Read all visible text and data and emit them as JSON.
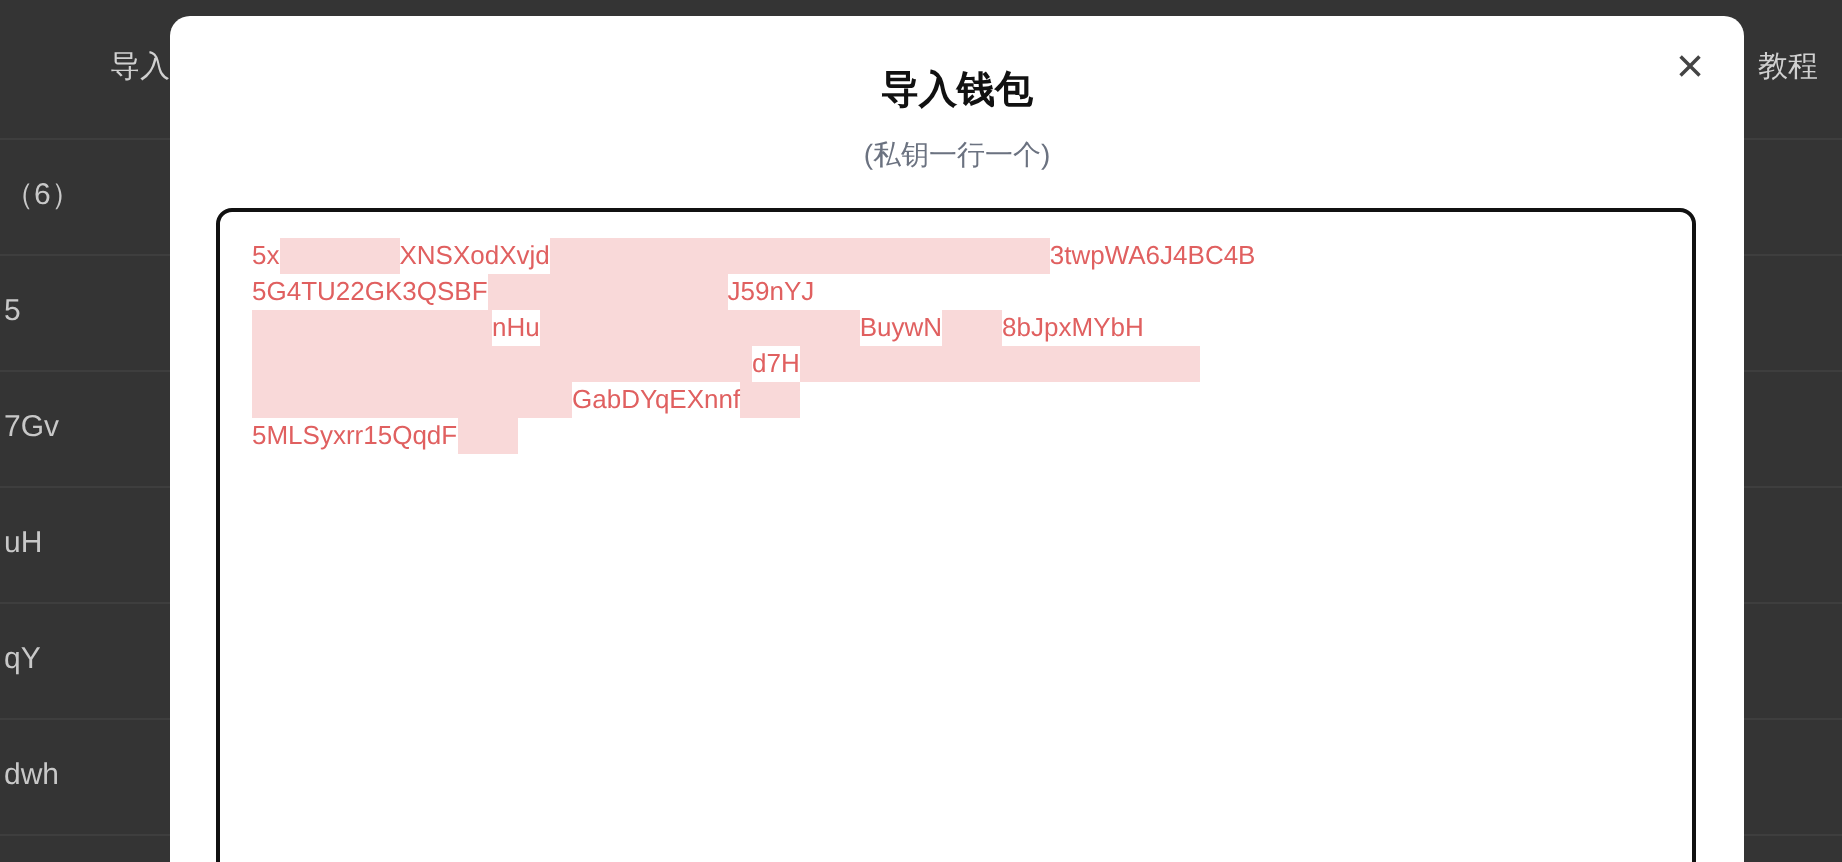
{
  "background_table": {
    "header": [
      "导入",
      "教程"
    ],
    "rows": [
      "（6）",
      "5",
      "7Gv",
      "uH",
      "qY",
      "dwh"
    ]
  },
  "dialog": {
    "title": "导入钱包",
    "subtitle": "(私钥一行一个)",
    "close": "×",
    "lines": [
      [
        {
          "kind": "text",
          "text": "5x"
        },
        {
          "kind": "mosaic"
        },
        {
          "kind": "text",
          "text": "XNSXodXvjd"
        },
        {
          "kind": "mosaic"
        },
        {
          "kind": "text",
          "text": "3twpWA6J4BC4B"
        }
      ],
      [
        {
          "kind": "text",
          "text": "5G4TU22GK3QSBF"
        },
        {
          "kind": "mosaic"
        },
        {
          "kind": "text",
          "text": "J59nYJ"
        }
      ],
      [
        {
          "kind": "mosaic"
        },
        {
          "kind": "text",
          "text": "nHu"
        },
        {
          "kind": "mosaic"
        },
        {
          "kind": "text",
          "text": "BuywN"
        },
        {
          "kind": "mosaic"
        },
        {
          "kind": "text",
          "text": "8bJpxMYbH"
        }
      ],
      [
        {
          "kind": "mosaic"
        },
        {
          "kind": "text",
          "text": "d7H"
        },
        {
          "kind": "mosaic"
        }
      ],
      [
        {
          "kind": "mosaic"
        },
        {
          "kind": "text",
          "text": "GabDYqEXnnf"
        },
        {
          "kind": "mosaic"
        }
      ],
      [
        {
          "kind": "text",
          "text": "5MLSyxrr15QqdF"
        },
        {
          "kind": "mosaic"
        }
      ]
    ]
  }
}
